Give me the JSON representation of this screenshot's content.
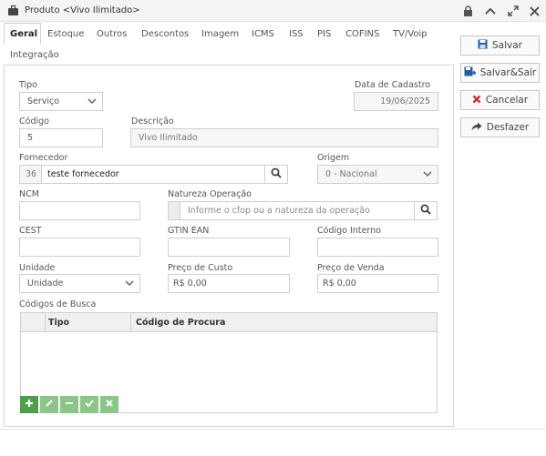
{
  "window": {
    "title": "Produto <Vivo Ilimitado>"
  },
  "tabs": [
    "Geral",
    "Estoque",
    "Outros",
    "Descontos",
    "Imagem",
    "ICMS",
    "ISS",
    "PIS",
    "COFINS",
    "TV/Voip",
    "Integração"
  ],
  "actions": {
    "save": "Salvar",
    "save_exit": "Salvar&Sair",
    "cancel": "Cancelar",
    "undo": "Desfazer"
  },
  "form": {
    "tipo": {
      "label": "Tipo",
      "value": "Serviço"
    },
    "data_cadastro": {
      "label": "Data de Cadastro",
      "value": "19/06/2025"
    },
    "codigo": {
      "label": "Código",
      "value": "5"
    },
    "descricao": {
      "label": "Descrição",
      "value": "Vivo Ilimitado"
    },
    "fornecedor": {
      "label": "Fornecedor",
      "code": "36",
      "name": "teste fornecedor"
    },
    "origem": {
      "label": "Origem",
      "value": "0 - Nacional"
    },
    "ncm": {
      "label": "NCM",
      "value": ""
    },
    "natureza": {
      "label": "Natureza Operação",
      "placeholder": "Informe o cfop ou a natureza da operação"
    },
    "cest": {
      "label": "CEST",
      "value": ""
    },
    "gtin": {
      "label": "GTIN EAN",
      "value": ""
    },
    "codigo_interno": {
      "label": "Código Interno",
      "value": ""
    },
    "unidade": {
      "label": "Unidade",
      "value": "Unidade"
    },
    "preco_custo": {
      "label": "Preço de Custo",
      "value": "R$ 0,00"
    },
    "preco_venda": {
      "label": "Preço de Venda",
      "value": "R$ 0,00"
    }
  },
  "busca": {
    "label": "Códigos de Busca",
    "columns": [
      "Tipo",
      "Código de Procura"
    ],
    "rows": []
  },
  "colors": {
    "accent_green": "#4e9f49",
    "disabled_green": "#8bc587",
    "cancel_red": "#c9302c",
    "save_blue": "#1f5fa6"
  }
}
